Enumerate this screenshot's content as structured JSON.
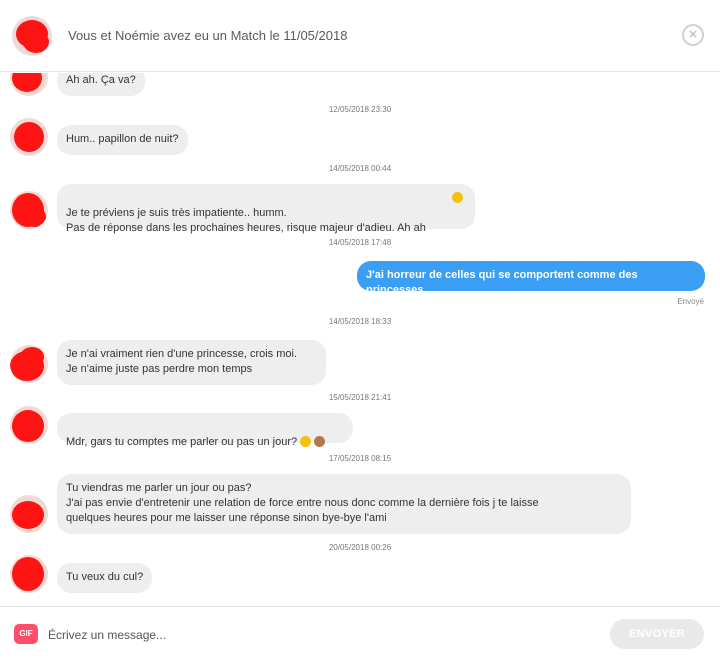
{
  "header": {
    "title": "Vous et Noémie avez eu un Match le 11/05/2018",
    "close_icon": "close-circle-icon"
  },
  "messages": [
    {
      "text": "Ah ah. Ça va?"
    },
    {
      "timestamp": "12/05/2018 23:30"
    },
    {
      "text": "Hum.. papillon de nuit?"
    },
    {
      "timestamp": "14/05/2018 00:44"
    },
    {
      "text": "Je te préviens je suis très impatiente.. humm.\nPas de réponse dans les prochaines heures, risque majeur d'adieu. Ah ah",
      "emoji": "laughing-emoji"
    },
    {
      "timestamp": "14/05/2018 17:48"
    },
    {
      "text": "J'ai horreur de celles qui se comportent comme des princesses",
      "status": "Envoyé"
    },
    {
      "timestamp": "14/05/2018 18:33"
    },
    {
      "text": "Je n'ai vraiment rien d'une princesse, crois moi.\nJe n'aime juste pas perdre mon temps"
    },
    {
      "timestamp": "15/05/2018 21:41"
    },
    {
      "text": "Mdr, gars tu comptes me parler ou pas un jour?",
      "emoji": "laughing-emoji",
      "emoji2": "see-no-evil-monkey-emoji"
    },
    {
      "timestamp": "17/05/2018 08:15"
    },
    {
      "text": "Tu viendras me parler un jour ou pas?\nJ'ai pas envie d'entretenir une relation de force entre nous donc comme la dernière fois j te laisse\nquelques heures pour me laisser une réponse sinon bye-bye l'ami"
    },
    {
      "timestamp": "20/05/2018 00:26"
    },
    {
      "text": "Tu veux du cul?"
    }
  ],
  "footer": {
    "gif_label": "GIF",
    "placeholder": "Écrivez un message...",
    "send_label": "ENVOYER"
  },
  "colors": {
    "accent": "#fd5068",
    "sent_bubble": "#3a9ef4",
    "received_bubble": "#eeeeee",
    "redaction": "#ff1414"
  }
}
